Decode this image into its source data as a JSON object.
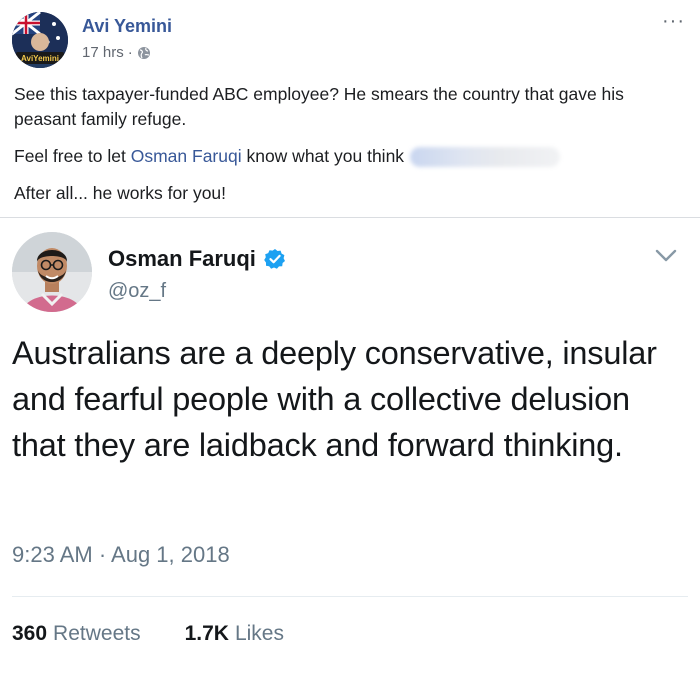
{
  "post": {
    "author": "Avi Yemini",
    "timestamp": "17 hrs",
    "separator": "·",
    "avatar_caption": "AviYemini",
    "more_label": "···",
    "paragraph1": "See this taxpayer-funded ABC employee? He smears the country that gave his peasant family refuge.",
    "paragraph2_prefix": "Feel free to let ",
    "paragraph2_link": "Osman Faruqi",
    "paragraph2_suffix": " know what you think",
    "paragraph3": "After all... he works for you!",
    "link_color": "#385898"
  },
  "tweet": {
    "name": "Osman Faruqi",
    "handle": "@oz_f",
    "text": "Australians are a deeply conservative, insular and fearful people with a collective delusion that they are laidback and forward thinking.",
    "time": "9:23 AM · Aug 1, 2018",
    "retweets_count": "360",
    "retweets_label": "Retweets",
    "likes_count": "1.7K",
    "likes_label": "Likes",
    "verified_color": "#1da1f2"
  },
  "icons": {
    "globe": "globe-icon",
    "verified": "verified-badge-icon",
    "chevron": "chevron-down-icon",
    "more": "more-options-icon"
  }
}
